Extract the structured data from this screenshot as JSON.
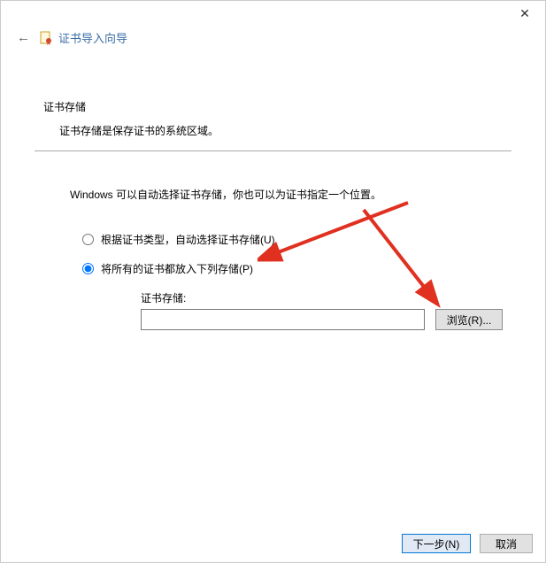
{
  "titlebar": {
    "close_symbol": "✕"
  },
  "header": {
    "back_symbol": "←",
    "wizard_title": "证书导入向导"
  },
  "content": {
    "section_title": "证书存储",
    "section_desc": "证书存储是保存证书的系统区域。",
    "body_text": "Windows 可以自动选择证书存储，你也可以为证书指定一个位置。",
    "radio_auto": "根据证书类型，自动选择证书存储(U)",
    "radio_manual": "将所有的证书都放入下列存储(P)",
    "store_label": "证书存储:",
    "store_value": "",
    "browse_label": "浏览(R)..."
  },
  "footer": {
    "next_label": "下一步(N)",
    "cancel_label": "取消"
  }
}
